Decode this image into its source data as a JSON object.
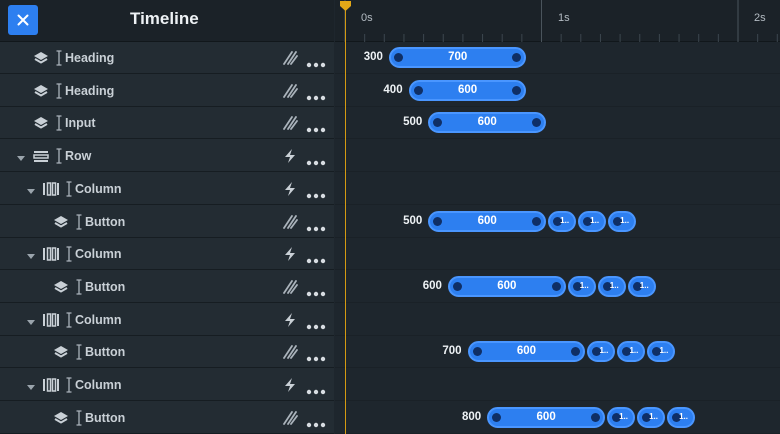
{
  "header": {
    "title": "Timeline",
    "close_icon": "close-icon"
  },
  "ruler": {
    "labels": [
      "0s",
      "1s",
      "2s"
    ]
  },
  "layers": [
    {
      "label": "Heading",
      "icon": "layers-icon",
      "action": "stagger-icon",
      "expandable": false,
      "depth": 1
    },
    {
      "label": "Heading",
      "icon": "layers-icon",
      "action": "stagger-icon",
      "expandable": false,
      "depth": 1
    },
    {
      "label": "Input",
      "icon": "layers-icon",
      "action": "stagger-icon",
      "expandable": false,
      "depth": 1
    },
    {
      "label": "Row",
      "icon": "row-icon",
      "action": "lightning-icon",
      "expandable": true,
      "depth": 0
    },
    {
      "label": "Column",
      "icon": "column-icon",
      "action": "lightning-icon",
      "expandable": true,
      "depth": 1
    },
    {
      "label": "Button",
      "icon": "layers-icon",
      "action": "stagger-icon",
      "expandable": false,
      "depth": 2
    },
    {
      "label": "Column",
      "icon": "column-icon",
      "action": "lightning-icon",
      "expandable": true,
      "depth": 1
    },
    {
      "label": "Button",
      "icon": "layers-icon",
      "action": "stagger-icon",
      "expandable": false,
      "depth": 2
    },
    {
      "label": "Column",
      "icon": "column-icon",
      "action": "lightning-icon",
      "expandable": true,
      "depth": 1
    },
    {
      "label": "Button",
      "icon": "layers-icon",
      "action": "stagger-icon",
      "expandable": false,
      "depth": 2
    },
    {
      "label": "Column",
      "icon": "column-icon",
      "action": "lightning-icon",
      "expandable": true,
      "depth": 1
    },
    {
      "label": "Button",
      "icon": "layers-icon",
      "action": "stagger-icon",
      "expandable": false,
      "depth": 2
    }
  ],
  "tracks": [
    {
      "delay": "300",
      "duration": "700",
      "extra": []
    },
    {
      "delay": "400",
      "duration": "600",
      "extra": []
    },
    {
      "delay": "500",
      "duration": "600",
      "extra": []
    },
    null,
    null,
    {
      "delay": "500",
      "duration": "600",
      "extra": [
        "1..",
        "1..",
        "1.."
      ]
    },
    null,
    {
      "delay": "600",
      "duration": "600",
      "extra": [
        "1..",
        "1..",
        "1.."
      ]
    },
    null,
    {
      "delay": "700",
      "duration": "600",
      "extra": [
        "1..",
        "1..",
        "1.."
      ]
    },
    null,
    {
      "delay": "800",
      "duration": "600",
      "extra": [
        "1..",
        "1..",
        "1.."
      ]
    }
  ],
  "colors": {
    "accent": "#2d7ff0",
    "playhead": "#d49a12"
  }
}
